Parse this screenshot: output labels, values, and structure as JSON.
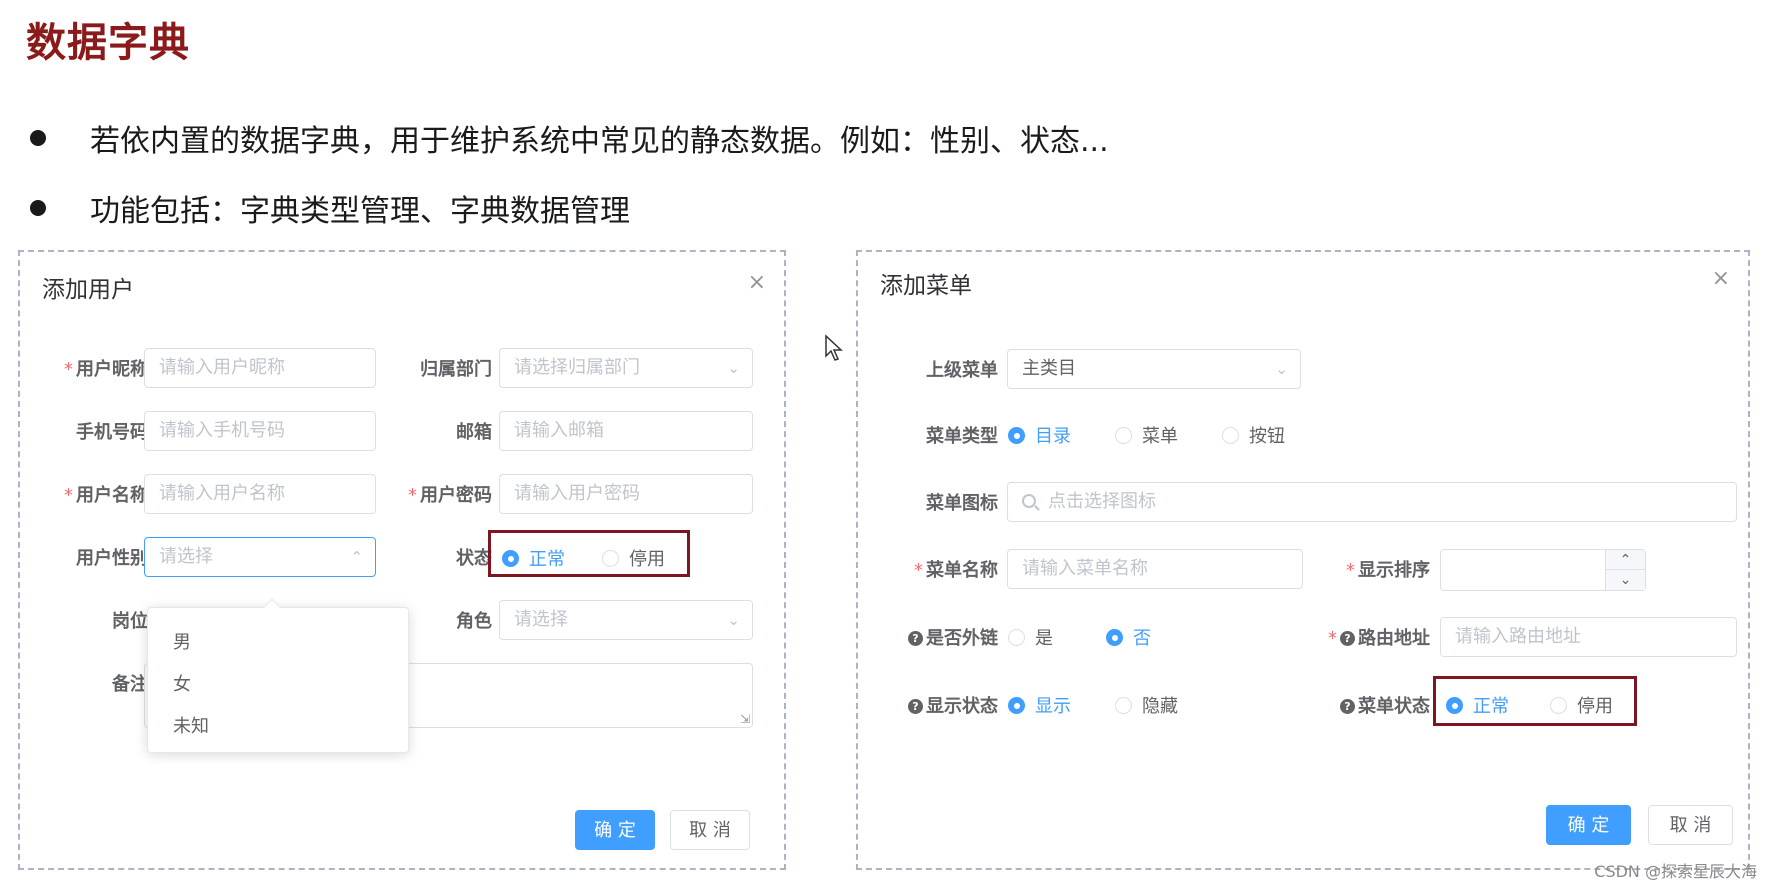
{
  "slide": {
    "title": "数据字典",
    "bullets": [
      "若依内置的数据字典，用于维护系统中常见的静态数据。例如：性别、状态...",
      "功能包括：字典类型管理、字典数据管理"
    ]
  },
  "user_dialog": {
    "title": "添加用户",
    "close": "×",
    "fields": {
      "nickname": {
        "label": "用户昵称",
        "placeholder": "请输入用户昵称"
      },
      "dept": {
        "label": "归属部门",
        "placeholder": "请选择归属部门"
      },
      "phone": {
        "label": "手机号码",
        "placeholder": "请输入手机号码"
      },
      "email": {
        "label": "邮箱",
        "placeholder": "请输入邮箱"
      },
      "username": {
        "label": "用户名称",
        "placeholder": "请输入用户名称"
      },
      "password": {
        "label": "用户密码",
        "placeholder": "请输入用户密码"
      },
      "gender": {
        "label": "用户性别",
        "placeholder": "请选择",
        "options": [
          "男",
          "女",
          "未知"
        ]
      },
      "status": {
        "label": "状态",
        "options": [
          "正常",
          "停用"
        ],
        "selected": "正常"
      },
      "post": {
        "label": "岗位"
      },
      "role": {
        "label": "角色",
        "placeholder": "请选择"
      },
      "remark": {
        "label": "备注"
      }
    },
    "confirm": "确 定",
    "cancel": "取 消"
  },
  "menu_dialog": {
    "title": "添加菜单",
    "close": "×",
    "fields": {
      "parent": {
        "label": "上级菜单",
        "value": "主类目"
      },
      "menu_type": {
        "label": "菜单类型",
        "options": [
          "目录",
          "菜单",
          "按钮"
        ],
        "selected": "目录"
      },
      "icon": {
        "label": "菜单图标",
        "placeholder": "点击选择图标"
      },
      "name": {
        "label": "菜单名称",
        "placeholder": "请输入菜单名称"
      },
      "sort": {
        "label": "显示排序"
      },
      "external": {
        "label": "是否外链",
        "options": [
          "是",
          "否"
        ],
        "selected": "否"
      },
      "route": {
        "label": "路由地址",
        "placeholder": "请输入路由地址"
      },
      "visible": {
        "label": "显示状态",
        "options": [
          "显示",
          "隐藏"
        ],
        "selected": "显示"
      },
      "menu_status": {
        "label": "菜单状态",
        "options": [
          "正常",
          "停用"
        ],
        "selected": "正常"
      }
    },
    "confirm": "确 定",
    "cancel": "取 消"
  },
  "watermark": "CSDN @探索星辰大海",
  "colors": {
    "accent": "#409eff",
    "title": "#8b1a1a",
    "highlight": "#7b1622",
    "required": "#f56c6c"
  }
}
